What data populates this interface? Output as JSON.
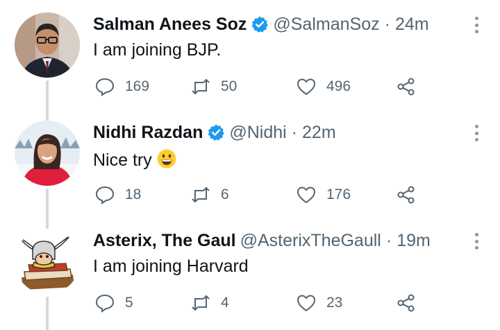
{
  "tweets": [
    {
      "name": "Salman Anees Soz",
      "verified": true,
      "handle": "@SalmanSoz",
      "separator": "·",
      "time": "24m",
      "text": "I am joining BJP.",
      "emoji": "",
      "replies": "169",
      "retweets": "50",
      "likes": "496",
      "avatar_icon": "man-with-glasses-avatar"
    },
    {
      "name": "Nidhi Razdan",
      "verified": true,
      "handle": "@Nidhi",
      "separator": "·",
      "time": "22m",
      "text": "Nice try",
      "emoji": "grinning-face-emoji",
      "replies": "18",
      "retweets": "6",
      "likes": "176",
      "avatar_icon": "woman-in-snow-avatar"
    },
    {
      "name": "Asterix, The Gaul",
      "verified": false,
      "handle": "@AsterixTheGaull",
      "separator": "·",
      "time": "19m",
      "text": "I am joining Harvard",
      "emoji": "",
      "replies": "5",
      "retweets": "4",
      "likes": "23",
      "avatar_icon": "asterix-cartoon-avatar"
    }
  ],
  "colors": {
    "text": "#0f1419",
    "secondary": "#536471",
    "verified": "#1d9bf0",
    "thread_line": "#cfd9de"
  }
}
